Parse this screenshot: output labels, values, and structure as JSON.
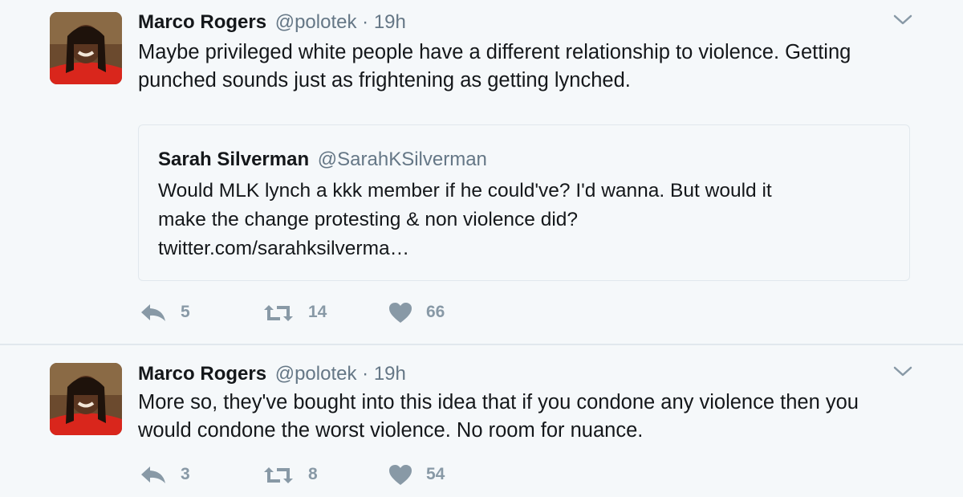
{
  "colors": {
    "background": "#f5f8fa",
    "name": "#14171a",
    "secondary": "#657786",
    "action_icon": "#8899a6",
    "border": "#e1e8ed"
  },
  "tweets": [
    {
      "author": {
        "name": "Marco Rogers",
        "handle": "@polotek",
        "avatar_icon": "profile-photo"
      },
      "separator": "·",
      "time": "19h",
      "text": "Maybe privileged white people have a different relationship to violence. Getting punched sounds just as frightening as getting lynched.",
      "quoted": {
        "name": "Sarah Silverman",
        "handle": "@SarahKSilverman",
        "lines": [
          "Would MLK lynch a kkk member if he could've? I'd wanna. But would it",
          "make the change protesting & non violence did?",
          "twitter.com/sarahksilverma…"
        ]
      },
      "actions": {
        "replies": "5",
        "retweets": "14",
        "likes": "66"
      }
    },
    {
      "author": {
        "name": "Marco Rogers",
        "handle": "@polotek",
        "avatar_icon": "profile-photo"
      },
      "separator": "·",
      "time": "19h",
      "text": "More so, they've bought into this idea that if you condone any violence then you would condone the worst violence. No room for nuance.",
      "actions": {
        "replies": "3",
        "retweets": "8",
        "likes": "54"
      }
    }
  ]
}
